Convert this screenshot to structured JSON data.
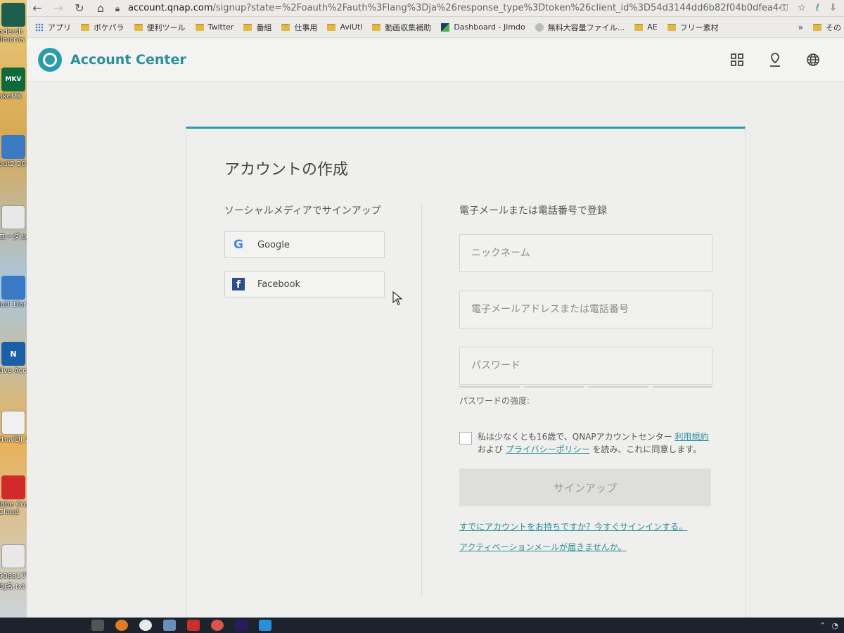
{
  "browser": {
    "url_host": "account.qnap.com",
    "url_rest": "/signup?state=%2Foauth%2Fauth%3Flang%3Dja%26response_type%3Dtoken%26client_id%3D54d3144dd6b82f04b0dfea44%26redir..."
  },
  "bookmarks": [
    {
      "label": "アプリ",
      "icon": "apps-grid-icon"
    },
    {
      "label": "ボケパラ",
      "icon": "folder-icon"
    },
    {
      "label": "便利ツール",
      "icon": "folder-icon"
    },
    {
      "label": "Twitter",
      "icon": "folder-icon"
    },
    {
      "label": "番組",
      "icon": "folder-icon"
    },
    {
      "label": "仕事用",
      "icon": "folder-icon"
    },
    {
      "label": "AviUtl",
      "icon": "folder-icon"
    },
    {
      "label": "動画収集補助",
      "icon": "folder-icon"
    },
    {
      "label": "Dashboard - Jimdo",
      "icon": "jimdo-icon"
    },
    {
      "label": "無料大容量ファイル...",
      "icon": "web-icon"
    },
    {
      "label": "AE",
      "icon": "folder-icon"
    },
    {
      "label": "フリー素材",
      "icon": "folder-icon"
    }
  ],
  "bookmarks_overflow": "»",
  "bookmarks_other": "その",
  "header": {
    "brand": "Account Center"
  },
  "card": {
    "title": "アカウントの作成",
    "social": {
      "label": "ソーシャルメディアでサインアップ",
      "google": "Google",
      "facebook": "Facebook"
    },
    "register": {
      "label": "電子メールまたは電話番号で登録",
      "nickname_placeholder": "ニックネーム",
      "email_placeholder": "電子メールアドレスまたは電話番号",
      "password_placeholder": "パスワード",
      "strength_label": "パスワードの強度:",
      "agree_pre": "私は少なくとも16歳で、QNAPアカウントセンター ",
      "terms_link": "利用規約",
      "agree_mid": " および ",
      "privacy_link": "プライバシーポリシー",
      "agree_post": " を読み、これに同意します。",
      "signup_button": "サインアップ",
      "signin_link": "すでにアカウントをお持ちですか？今すぐサインインする。",
      "activation_link": "アクティベーションメールが届きませんか。"
    }
  },
  "desktop_icons": [
    {
      "label": "ndersh",
      "label2": "ilmoras",
      "color": "#1e5e4f",
      "icon": "app-icon"
    },
    {
      "label": "akeMK",
      "color": "#0f6a3a",
      "icon": "mkv-icon",
      "glyph": "MKV"
    },
    {
      "label": "out2-20",
      "color": "#3a79c4",
      "icon": "file-icon"
    },
    {
      "label": "ユーダ.txt",
      "color": "#e8e8e8",
      "icon": "text-file-icon"
    },
    {
      "label": "iutl 1for",
      "color": "#3a79c4",
      "icon": "file-icon"
    },
    {
      "label": "tive Acc",
      "color": "#1a5fa8",
      "icon": "app-icon",
      "glyph": "N"
    },
    {
      "label": "rtualDJ 20",
      "color": "#f0f0f0",
      "icon": "file-icon"
    },
    {
      "label": "lobe Crea",
      "label2": "Cloud",
      "color": "#d22a2a",
      "icon": "creative-cloud-icon"
    },
    {
      "label": "90831アル",
      "label2": "DJ名.txt",
      "color": "#e8e8e8",
      "icon": "text-file-icon"
    }
  ],
  "colors": {
    "accent": "#2b9cab",
    "link": "#2b8e9b"
  }
}
